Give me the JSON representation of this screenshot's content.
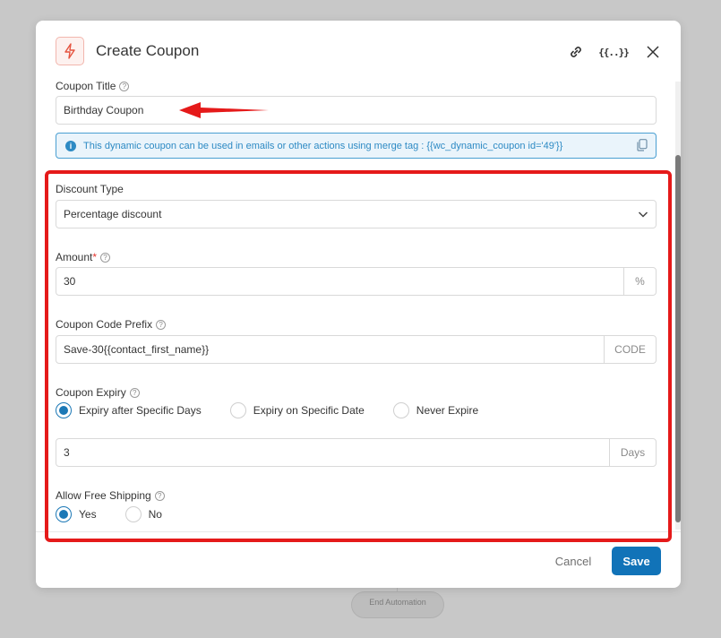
{
  "background": {
    "pill_label": "End Automation"
  },
  "modal": {
    "title": "Create Coupon",
    "header_icons": [
      "bolt-icon",
      "link-icon",
      "merge-tag-icon",
      "close-icon"
    ],
    "merge_icon_text": "{{..}}"
  },
  "coupon_title": {
    "label": "Coupon Title",
    "value": "Birthday Coupon"
  },
  "info": {
    "text": "This dynamic coupon can be used in emails or other actions using merge tag : {{wc_dynamic_coupon id='49'}}",
    "icon_glyph": "i"
  },
  "discount_type": {
    "label": "Discount Type",
    "value": "Percentage discount"
  },
  "amount": {
    "label": "Amount",
    "required_mark": "*",
    "value": "30",
    "suffix": "%"
  },
  "prefix": {
    "label": "Coupon Code Prefix",
    "value": "Save-30{{contact_first_name}}",
    "suffix": "CODE"
  },
  "expiry": {
    "label": "Coupon Expiry",
    "options": [
      "Expiry after Specific Days",
      "Expiry on Specific Date",
      "Never Expire"
    ],
    "selected": "Expiry after Specific Days",
    "days_value": "3",
    "days_suffix": "Days"
  },
  "shipping": {
    "label": "Allow Free Shipping",
    "options": [
      "Yes",
      "No"
    ],
    "selected": "Yes"
  },
  "footer": {
    "cancel_label": "Cancel",
    "save_label": "Save"
  },
  "colors": {
    "accent": "#1173b8",
    "annotation_red": "#e51a1a",
    "info_blue": "#2d8ac4"
  },
  "help_glyph": "?"
}
